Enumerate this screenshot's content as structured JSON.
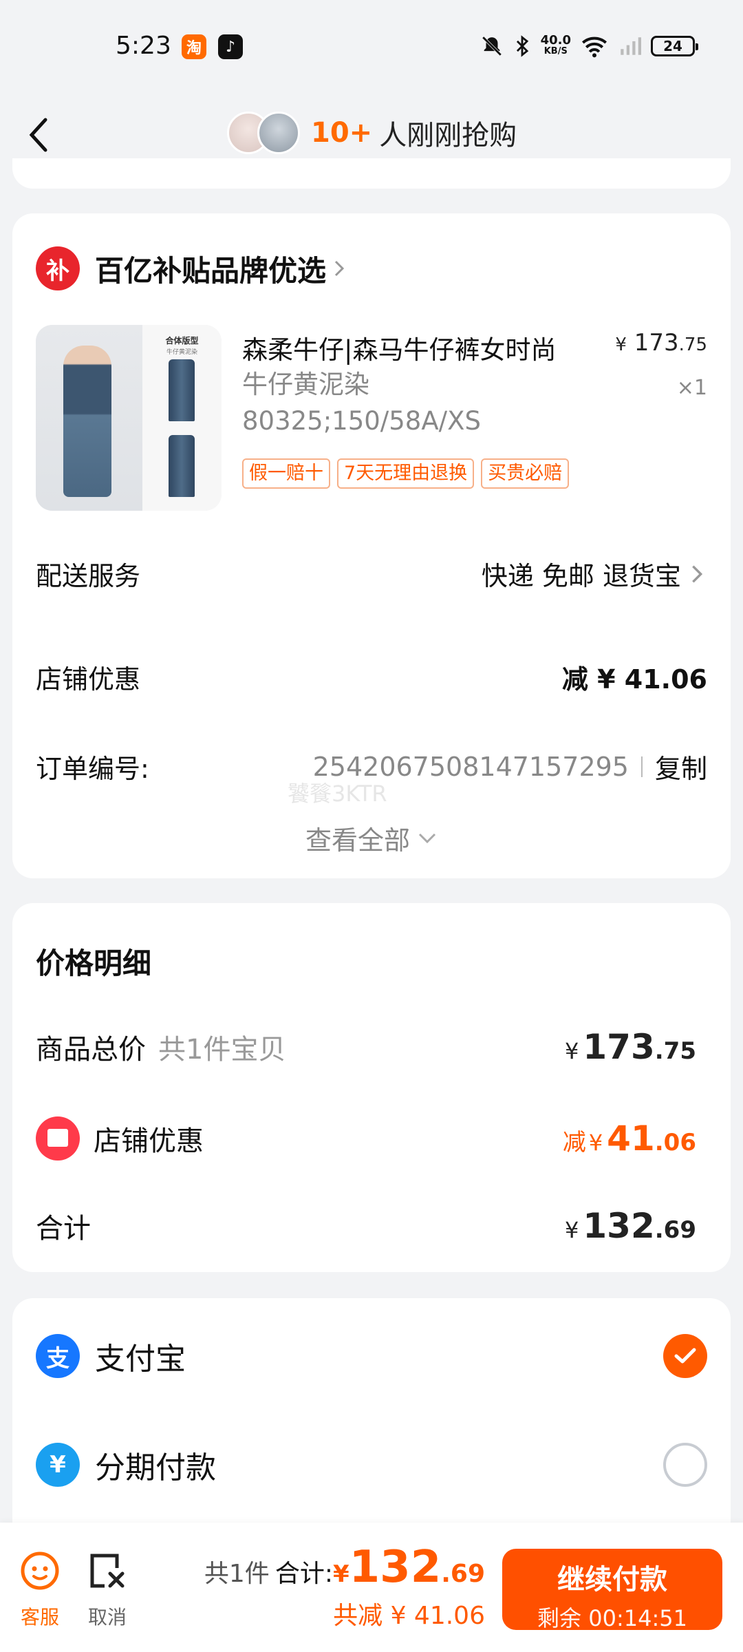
{
  "status_bar": {
    "time": "5:23",
    "app1": "淘",
    "app2": "♪",
    "net_speed": "40.0",
    "net_unit": "KB/S",
    "battery": "24"
  },
  "header": {
    "count": "10+",
    "text": "人刚刚抢购"
  },
  "order": {
    "shop_badge": "补",
    "shop_name": "百亿补贴品牌优选",
    "product": {
      "image_caption": "合体版型",
      "image_subcaption": "牛仔黄泥染",
      "title": "森柔牛仔|森马牛仔裤女时尚",
      "spec": "牛仔黄泥染80325;150/58A/XS",
      "price_yen": "¥",
      "price_int": "173",
      "price_dec": ".75",
      "qty": "×1",
      "tags": [
        "假一赔十",
        "7天无理由退换",
        "买贵必赔"
      ]
    },
    "delivery": {
      "label": "配送服务",
      "value": "快递 免邮 退货宝"
    },
    "shop_discount": {
      "label": "店铺优惠",
      "value": "减 ¥ 41.06"
    },
    "order_no": {
      "label": "订单编号:",
      "value": "2542067508147157295",
      "copy": "复制"
    },
    "watermark": "饕餮3KTR",
    "view_all": "查看全部"
  },
  "price_detail": {
    "title": "价格明细",
    "goods_total": {
      "label": "商品总价",
      "sub": "共1件宝贝",
      "yen": "¥",
      "int": "173",
      "dec": ".75"
    },
    "shop_discount": {
      "label": "店铺优惠",
      "prefix": "减",
      "yen": "¥",
      "int": "41",
      "dec": ".06"
    },
    "total": {
      "label": "合计",
      "yen": "¥",
      "int": "132",
      "dec": ".69"
    }
  },
  "payment": {
    "methods": [
      {
        "name": "支付宝",
        "icon": "支",
        "selected": true
      },
      {
        "name": "分期付款",
        "icon": "¥",
        "selected": false
      }
    ]
  },
  "bottom": {
    "service": "客服",
    "cancel": "取消",
    "count": "共1件",
    "total_label": "合计:",
    "yen": "¥",
    "int": "132",
    "dec": ".69",
    "saved": "共减 ¥ 41.06",
    "pay_button": "继续付款",
    "remaining": "剩余 00:14:51"
  },
  "colors": {
    "accent": "#ff5000",
    "subsidy_red": "#e8252c",
    "alipay_blue": "#1677ff"
  }
}
